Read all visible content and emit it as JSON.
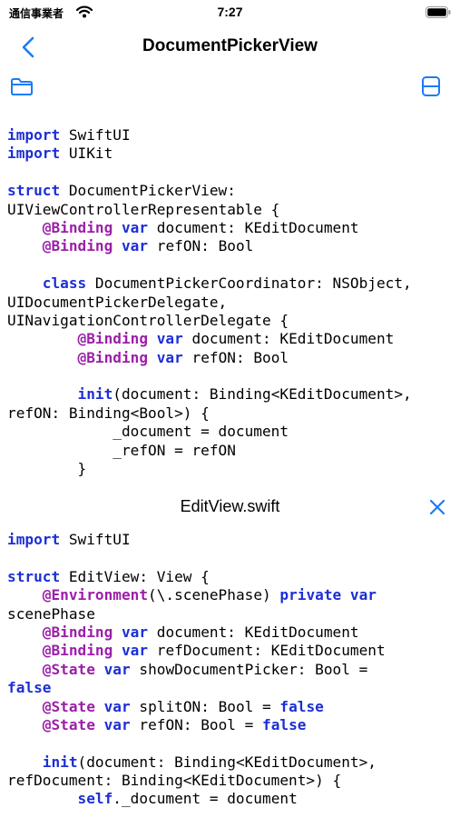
{
  "status_bar": {
    "carrier": "通信事業者",
    "time": "7:27"
  },
  "nav": {
    "title": "DocumentPickerView"
  },
  "icons": {
    "back": "chevron-left-icon",
    "folder": "folder-icon",
    "split": "split-view-icon",
    "close": "close-icon"
  },
  "colors": {
    "accent": "#1a7cf6",
    "keyword": "#1d2fd6",
    "attribute": "#9b1fa8"
  },
  "top_code": [
    [
      {
        "t": "import",
        "k": "kw"
      },
      {
        "t": " SwiftUI"
      }
    ],
    [
      {
        "t": "import",
        "k": "kw"
      },
      {
        "t": " UIKit"
      }
    ],
    [],
    [
      {
        "t": "struct",
        "k": "kw"
      },
      {
        "t": " DocumentPickerView:"
      }
    ],
    [
      {
        "t": "UIViewControllerRepresentable {"
      }
    ],
    [
      {
        "t": "    "
      },
      {
        "t": "@Binding",
        "k": "attr"
      },
      {
        "t": " "
      },
      {
        "t": "var",
        "k": "kw"
      },
      {
        "t": " document: KEditDocument"
      }
    ],
    [
      {
        "t": "    "
      },
      {
        "t": "@Binding",
        "k": "attr"
      },
      {
        "t": " "
      },
      {
        "t": "var",
        "k": "kw"
      },
      {
        "t": " refON: Bool"
      }
    ],
    [],
    [
      {
        "t": "    "
      },
      {
        "t": "class",
        "k": "kw"
      },
      {
        "t": " DocumentPickerCoordinator: NSObject,"
      }
    ],
    [
      {
        "t": "UIDocumentPickerDelegate,"
      }
    ],
    [
      {
        "t": "UINavigationControllerDelegate {"
      }
    ],
    [
      {
        "t": "        "
      },
      {
        "t": "@Binding",
        "k": "attr"
      },
      {
        "t": " "
      },
      {
        "t": "var",
        "k": "kw"
      },
      {
        "t": " document: KEditDocument"
      }
    ],
    [
      {
        "t": "        "
      },
      {
        "t": "@Binding",
        "k": "attr"
      },
      {
        "t": " "
      },
      {
        "t": "var",
        "k": "kw"
      },
      {
        "t": " refON: Bool"
      }
    ],
    [],
    [
      {
        "t": "        "
      },
      {
        "t": "init",
        "k": "kw"
      },
      {
        "t": "(document: Binding<KEditDocument>,"
      }
    ],
    [
      {
        "t": "refON: Binding<Bool>) {"
      }
    ],
    [
      {
        "t": "            _document = document"
      }
    ],
    [
      {
        "t": "            _refON = refON"
      }
    ],
    [
      {
        "t": "        }"
      }
    ]
  ],
  "file_header": {
    "title": "EditView.swift"
  },
  "bottom_code": [
    [
      {
        "t": "import",
        "k": "kw"
      },
      {
        "t": " SwiftUI"
      }
    ],
    [],
    [
      {
        "t": "struct",
        "k": "kw"
      },
      {
        "t": " EditView: View {"
      }
    ],
    [
      {
        "t": "    "
      },
      {
        "t": "@Environment",
        "k": "attr"
      },
      {
        "t": "(\\.scenePhase) "
      },
      {
        "t": "private",
        "k": "kw"
      },
      {
        "t": " "
      },
      {
        "t": "var",
        "k": "kw"
      }
    ],
    [
      {
        "t": "scenePhase"
      }
    ],
    [
      {
        "t": "    "
      },
      {
        "t": "@Binding",
        "k": "attr"
      },
      {
        "t": " "
      },
      {
        "t": "var",
        "k": "kw"
      },
      {
        "t": " document: KEditDocument"
      }
    ],
    [
      {
        "t": "    "
      },
      {
        "t": "@Binding",
        "k": "attr"
      },
      {
        "t": " "
      },
      {
        "t": "var",
        "k": "kw"
      },
      {
        "t": " refDocument: KEditDocument"
      }
    ],
    [
      {
        "t": "    "
      },
      {
        "t": "@State",
        "k": "attr"
      },
      {
        "t": " "
      },
      {
        "t": "var",
        "k": "kw"
      },
      {
        "t": " showDocumentPicker: Bool ="
      }
    ],
    [
      {
        "t": "false",
        "k": "kw"
      }
    ],
    [
      {
        "t": "    "
      },
      {
        "t": "@State",
        "k": "attr"
      },
      {
        "t": " "
      },
      {
        "t": "var",
        "k": "kw"
      },
      {
        "t": " splitON: Bool = "
      },
      {
        "t": "false",
        "k": "kw"
      }
    ],
    [
      {
        "t": "    "
      },
      {
        "t": "@State",
        "k": "attr"
      },
      {
        "t": " "
      },
      {
        "t": "var",
        "k": "kw"
      },
      {
        "t": " refON: Bool = "
      },
      {
        "t": "false",
        "k": "kw"
      }
    ],
    [],
    [
      {
        "t": "    "
      },
      {
        "t": "init",
        "k": "kw"
      },
      {
        "t": "(document: Binding<KEditDocument>,"
      }
    ],
    [
      {
        "t": "refDocument: Binding<KEditDocument>) {"
      }
    ],
    [
      {
        "t": "        "
      },
      {
        "t": "self",
        "k": "kw"
      },
      {
        "t": "._document = document"
      }
    ]
  ]
}
